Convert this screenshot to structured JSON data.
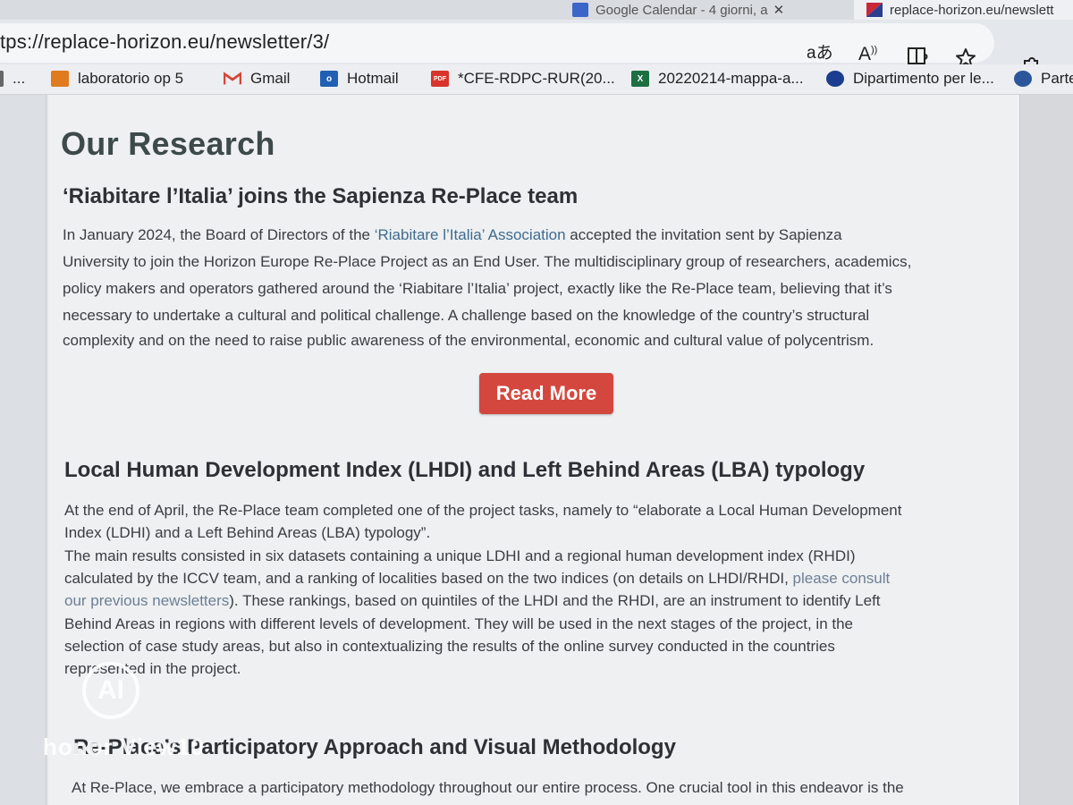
{
  "browser": {
    "tabs": [
      {
        "title": "Google Calendar - 4 giorni, a",
        "close": "✕"
      },
      {
        "title": "replace-horizon.eu/newslett"
      }
    ],
    "url": "tps://replace-horizon.eu/newsletter/3/",
    "toolbar_icons": [
      "translate-icon",
      "read-aloud-icon",
      "reading-view-icon",
      "favorite-star-icon",
      "extensions-icon"
    ],
    "bookmarks": [
      {
        "label": "...",
        "icon": "generic"
      },
      {
        "label": "laboratorio op 5",
        "icon": "folder",
        "color": "#e07b1e"
      },
      {
        "label": "Gmail",
        "icon": "gmail",
        "color": "#d44638"
      },
      {
        "label": "Hotmail",
        "icon": "outlook",
        "color": "#1f5fb4"
      },
      {
        "label": "*CFE-RDPC-RUR(20...",
        "icon": "pdf",
        "color": "#d9342b"
      },
      {
        "label": "20220214-mappa-a...",
        "icon": "excel",
        "color": "#1d6f42"
      },
      {
        "label": "Dipartimento per le...",
        "icon": "globe",
        "color": "#1a3d8f"
      },
      {
        "label": "Parte",
        "icon": "people",
        "color": "#2b579a"
      }
    ]
  },
  "page": {
    "title": "Our Research",
    "article1": {
      "heading": "‘Riabitare l’Italia’ joins the Sapienza Re-Place team",
      "lines": [
        [
          "In January 2024, the Board of Directors of the ",
          "‘Riabitare l’Italia’ Association",
          " accepted the invitation sent by Sapienza"
        ],
        [
          "University to join the Horizon Europe Re-Place Project as an End User. The multidisciplinary group of researchers, academics,"
        ],
        [
          "policy makers and operators gathered around the ‘Riabitare l’Italia’ project, exactly like the Re-Place team, believing that it’s"
        ],
        [
          "necessary to undertake a cultural and political challenge. A challenge based on the knowledge of the country’s structural"
        ],
        [
          "complexity and on the need to raise public awareness of the environmental, economic and cultural value of polycentrism."
        ]
      ],
      "button": "Read More"
    },
    "article2": {
      "heading": "Local Human Development Index (LHDI) and Left Behind Areas (LBA) typology",
      "lines": [
        [
          "At the end of April, the Re-Place team completed one of the project tasks, namely to “elaborate a Local Human Development"
        ],
        [
          "Index (LDHI) and a Left Behind Areas (LBA) typology”."
        ],
        [
          "The main results consisted in six datasets containing a unique LDHI and a regional human development index (RHDI)"
        ],
        [
          "calculated by the ICCV team, and a ranking of localities based on the two indices (on details on LHDI/RHDI, ",
          "please consult"
        ],
        [
          "our previous newsletters",
          "). These rankings, based on quintiles of the LHDI and the RHDI, are an instrument to identify Left"
        ],
        [
          "Behind Areas in regions with different levels of development. They will be used in the next stages of the project, in the"
        ],
        [
          "selection of case study areas, but also in contextualizing the results of the online survey conducted in the countries"
        ],
        [
          "represented in the project."
        ]
      ]
    },
    "article3": {
      "heading": "Re-Place’s Participatory Approach and Visual Methodology",
      "lines": [
        [
          "At Re-Place, we embrace a participatory methodology throughout our entire process. One crucial tool in this endeavor is the"
        ]
      ]
    }
  },
  "watermark": {
    "badge": "AI",
    "text": "honor View10"
  },
  "colors": {
    "button": "#d4473e",
    "link": "#3f6b8f",
    "heading": "#3e4a4a"
  }
}
